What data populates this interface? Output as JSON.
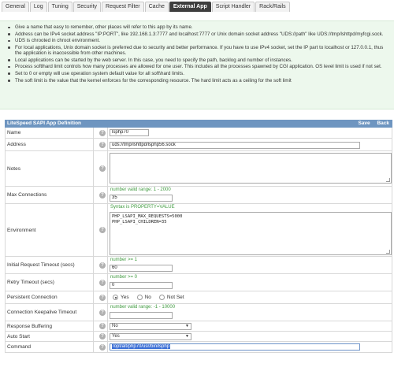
{
  "tabs": [
    "General",
    "Log",
    "Tuning",
    "Security",
    "Request Filter",
    "Cache",
    "External App",
    "Script Handler",
    "Rack/Rails"
  ],
  "active_tab": 6,
  "info": [
    "Give a name that easy to remember, other places will refer to this app by its name.",
    "Address can be IPv4 socket address \"IP:PORT\", like 192.168.1.3:7777 and localhost:7777 or Unix domain socket address \"UDS://path\" like UDS://tmp/lshttpd/myfcgi.sock.",
    "UDS is chrooted in chroot environment.",
    "For local applications, Unix domain socket is preferred due to security and better performance. If you have to use IPv4 socket, set the IP part to localhost or 127.0.0.1, thus the application is inaccessible from other machines.",
    "Local applications can be started by the web server. In this case, you need to specify the path, backlog and number of instances.",
    "Process softlhard limit controls how many processes are allowed for one user. This includes all the processes spawned by CGI application. OS level limit is used if not set.",
    "Set to 0 or empty will use operation system default value for all soft\\hard limits.",
    "The soft limit is the value that the kernel enforces for the corresponding resource. The hard limit acts as a ceiling for the soft limit"
  ],
  "panel": {
    "title": "LiteSpeed SAPI App Definition",
    "save_label": "Save",
    "back_label": "Back"
  },
  "form": {
    "name": {
      "label": "Name",
      "value": "lsphp70"
    },
    "address": {
      "label": "Address",
      "value": "uds://tmp/lshttpd/lsphp56.sock"
    },
    "notes": {
      "label": "Notes",
      "value": ""
    },
    "max_connections": {
      "label": "Max Connections",
      "hint": "number valid range: 1 - 2000",
      "value": "35"
    },
    "environment": {
      "label": "Environment",
      "hint": "Syntax is PROPERTY=VALUE",
      "lines": [
        "PHP_LSAPI_MAX_REQUESTS=5000",
        "PHP_LSAPI_CHILDREN=35"
      ]
    },
    "initial_timeout": {
      "label": "Initial Request Timeout (secs)",
      "hint": "number >= 1",
      "value": "60"
    },
    "retry_timeout": {
      "label": "Retry Timeout (secs)",
      "hint": "number >= 0",
      "value": "0"
    },
    "persistent": {
      "label": "Persistent Connection",
      "options": [
        "Yes",
        "No",
        "Not Set"
      ],
      "selected": "Yes"
    },
    "keepalive_timeout": {
      "label": "Connection Keepalive Timeout",
      "hint": "number valid range: -1 - 10000",
      "value": ""
    },
    "response_buffering": {
      "label": "Response Buffering",
      "value": "No"
    },
    "auto_start": {
      "label": "Auto Start",
      "value": "Yes"
    },
    "command": {
      "label": "Command",
      "value": "/opt/alt/php70/usr/bin/lsphp"
    }
  },
  "colors": {
    "active_tab": "#3e3e3e",
    "info_bg": "#edf8ed",
    "panel_header": "#6e95c0",
    "hint": "#3f9a3f"
  }
}
